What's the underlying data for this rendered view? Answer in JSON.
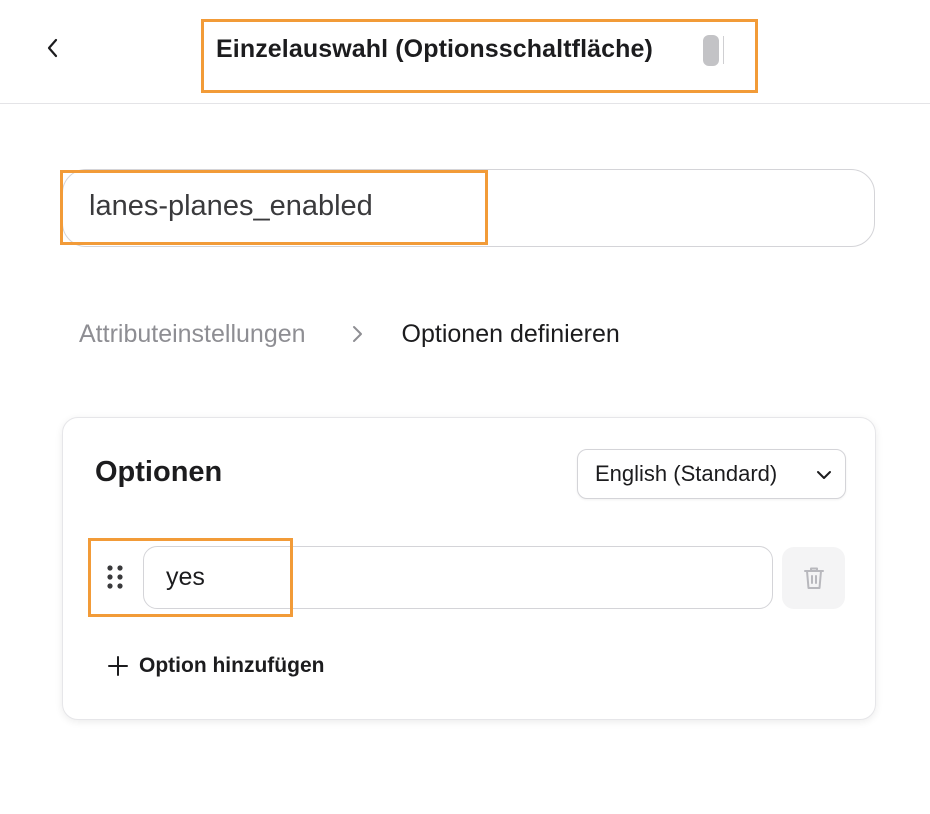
{
  "header": {
    "title": "Einzelauswahl (Optionsschaltfläche)",
    "back_icon": "chevron-left-icon"
  },
  "attribute": {
    "name_value": "lanes-planes_enabled"
  },
  "breadcrumb": {
    "step_1": "Attributeinstellungen",
    "separator_icon": "chevron-right-icon",
    "step_2": "Optionen definieren"
  },
  "options_card": {
    "title": "Optionen",
    "language_select": {
      "selected": "English (Standard)",
      "icon": "chevron-down-icon"
    },
    "items": [
      {
        "value": "yes",
        "drag_icon": "drag-handle-icon",
        "delete_icon": "trash-icon"
      }
    ],
    "add_option_label": "Option hinzufügen",
    "add_icon": "plus-icon"
  },
  "colors": {
    "highlight": "#f29b38",
    "border": "#d4d4d8",
    "muted_text": "#8e8e93",
    "text": "#1c1c1e"
  }
}
